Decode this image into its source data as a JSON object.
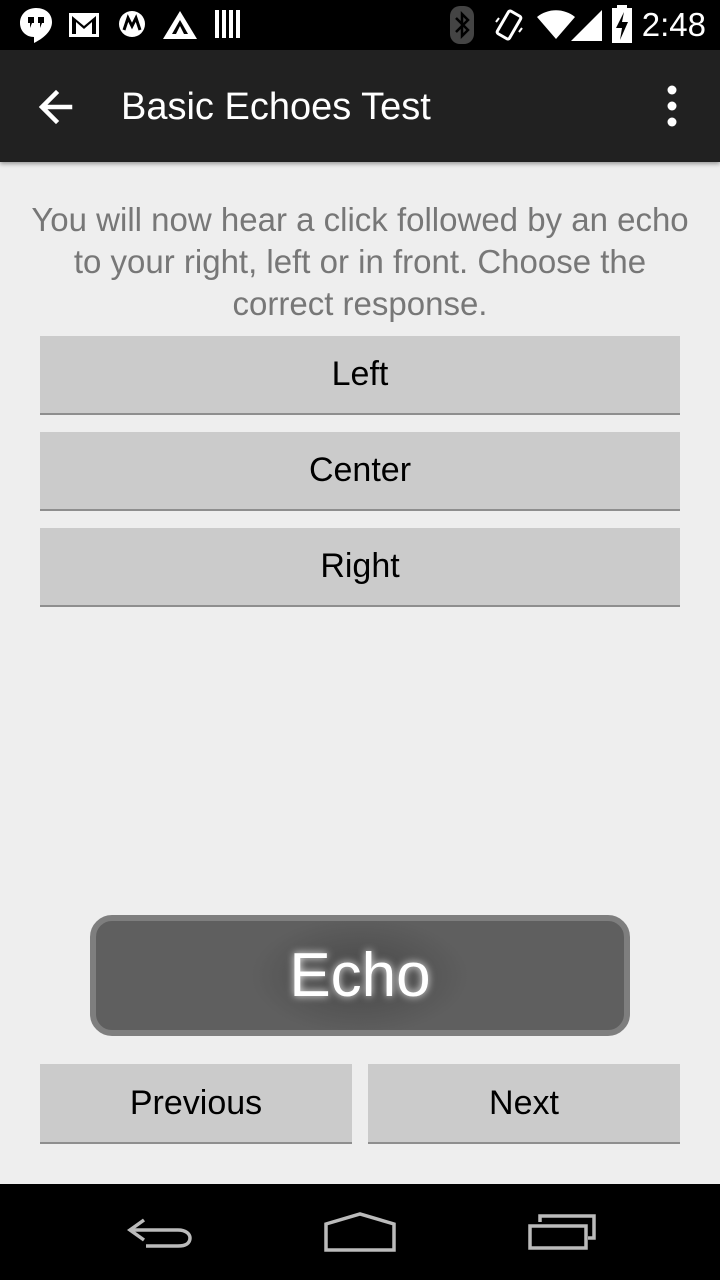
{
  "status_bar": {
    "time": "2:48",
    "icons": [
      "hangouts-icon",
      "gmail-icon",
      "motorola-icon",
      "triangle-app-icon",
      "barcode-icon",
      "bluetooth-icon",
      "vibrate-icon",
      "wifi-icon",
      "signal-icon",
      "battery-charging-icon"
    ]
  },
  "app_bar": {
    "title": "Basic Echoes Test",
    "back_icon": "arrow-left-icon",
    "menu_icon": "more-vert-icon"
  },
  "main": {
    "instructions": "You will now hear a click followed by an echo to your right, left or in front. Choose the correct response.",
    "choices": [
      {
        "label": "Left"
      },
      {
        "label": "Center"
      },
      {
        "label": "Right"
      }
    ],
    "echo_label": "Echo",
    "previous_label": "Previous",
    "next_label": "Next"
  },
  "nav_bar": {
    "icons": [
      "back-nav-icon",
      "home-nav-icon",
      "recents-nav-icon"
    ]
  },
  "colors": {
    "background": "#eeeeee",
    "app_bar": "#212121",
    "button": "#cbcbcb",
    "echo_button": "#5f5f5f",
    "instructions_text": "#777777"
  }
}
